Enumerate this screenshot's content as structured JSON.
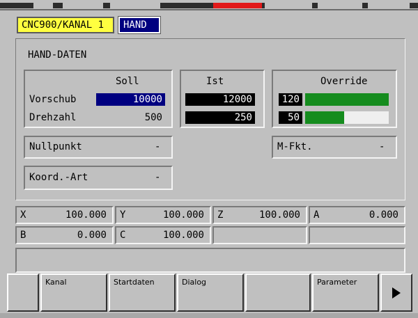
{
  "header": {
    "channel": "CNC900/KANAL 1",
    "mode": "HAND"
  },
  "hand_daten": {
    "title": "HAND-DATEN",
    "soll": {
      "heading": "Soll",
      "vorschub_label": "Vorschub",
      "vorschub_value": "10000",
      "drehzahl_label": "Drehzahl",
      "drehzahl_value": "500"
    },
    "ist": {
      "heading": "Ist",
      "vorschub_value": "12000",
      "drehzahl_value": "250"
    },
    "override": {
      "heading": "Override",
      "feed_value": "120",
      "feed_level_fraction": 1.0,
      "spindle_value": "50",
      "spindle_level_fraction": 0.47
    },
    "nullpunkt": {
      "label": "Nullpunkt",
      "value": "-"
    },
    "koord_art": {
      "label": "Koord.-Art",
      "value": "-"
    },
    "m_fkt": {
      "label": "M-Fkt.",
      "value": "-"
    }
  },
  "axes": [
    {
      "name": "X",
      "value": "100.000"
    },
    {
      "name": "Y",
      "value": "100.000"
    },
    {
      "name": "Z",
      "value": "100.000"
    },
    {
      "name": "A",
      "value": "0.000"
    },
    {
      "name": "B",
      "value": "0.000"
    },
    {
      "name": "C",
      "value": "100.000"
    }
  ],
  "softkeys": {
    "k1": "",
    "k2": "Kanal",
    "k3": "Startdaten",
    "k4": "Dialog",
    "k5": "",
    "k6": "Parameter",
    "next_icon": "triangle-right-icon"
  },
  "colors": {
    "background": "#c0c0c0",
    "channel_tag": "#ffff40",
    "mode_tag": "#000080",
    "selected_field": "#000080",
    "bar_green": "#158c1e",
    "active_indicator": "#e21a1a"
  }
}
